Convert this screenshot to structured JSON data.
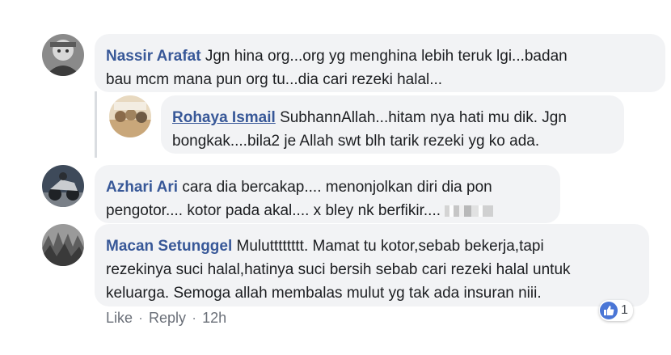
{
  "comments": [
    {
      "author": "Nassir Arafat",
      "line1": "Jgn hina org...org yg menghina lebih teruk lgi...badan",
      "line2": "bau mcm mana pun org tu...dia cari rezeki halal..."
    },
    {
      "author": "Rohaya Ismail",
      "line1": "SubhannAllah...hitam nya hati mu dik. Jgn",
      "line2": "bongkak....bila2 je Allah swt blh tarik rezeki yg ko ada."
    },
    {
      "author": "Azhari Ari",
      "line1": "cara dia bercakap.... menonjolkan diri dia pon",
      "line2": "pengotor.... kotor pada akal.... x bley nk berfikir...."
    },
    {
      "author": "Macan Setunggel",
      "line1": "Mulutttttttt. Mamat tu kotor,sebab bekerja,tapi",
      "line2": "rezekinya suci halal,hatinya suci bersih sebab cari rezeki halal untuk",
      "line3": "keluarga. Semoga allah membalas mulut yg tak ada insuran niii."
    }
  ],
  "actions": {
    "like": "Like",
    "reply": "Reply",
    "separator": "·",
    "time": "12h"
  },
  "reaction": {
    "count": "1",
    "icon": "thumbs-up-icon",
    "color": "#4a76d6"
  }
}
